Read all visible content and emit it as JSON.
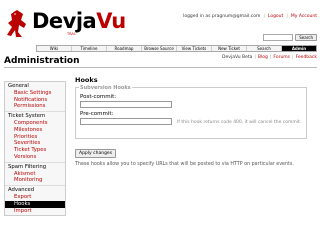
{
  "header": {
    "logo_text_1": "Devja",
    "logo_text_2": "Vu",
    "logo_sub": "TRAC",
    "metanav": {
      "logged_in": "logged in as pragnum@gmail.com",
      "logout": "Logout",
      "account": "My Account"
    },
    "search": {
      "button_label": "Search"
    }
  },
  "mainnav": {
    "tabs": [
      "Wiki",
      "Timeline",
      "Roadmap",
      "Browse Source",
      "View Tickets",
      "New Ticket",
      "Search",
      "Admin"
    ],
    "active_tab": "Admin"
  },
  "subnav": {
    "items": [
      "DevjaVu Beta",
      "Blog",
      "Forums",
      "Feedback"
    ]
  },
  "page": {
    "title": "Administration"
  },
  "sidebar": {
    "groups": [
      {
        "category": "General",
        "items": [
          "Basic Settings",
          "Notifications",
          "Permissions"
        ]
      },
      {
        "category": "Ticket System",
        "items": [
          "Components",
          "Milestones",
          "Priorities",
          "Severities",
          "Ticket Types",
          "Versions"
        ]
      },
      {
        "category": "Spam Filtering",
        "items": [
          "Akismet",
          "Monitoring"
        ]
      },
      {
        "category": "Advanced",
        "items": [
          "Export",
          "Hooks",
          "Import"
        ]
      }
    ],
    "active_item": "Hooks"
  },
  "content": {
    "heading": "Hooks",
    "fieldset_legend": "Subversion Hooks",
    "post_commit_label": "Post-commit:",
    "pre_commit_label": "Pre-commit:",
    "pre_commit_hint": "If this hook returns code 400, it will cancel the commit.",
    "apply_button": "Apply changes",
    "footnote": "These hooks allow you to specify URLs that will be posted to via HTTP on particular events."
  },
  "colors": {
    "accent": "#bb0000",
    "active_bg": "#000000"
  }
}
